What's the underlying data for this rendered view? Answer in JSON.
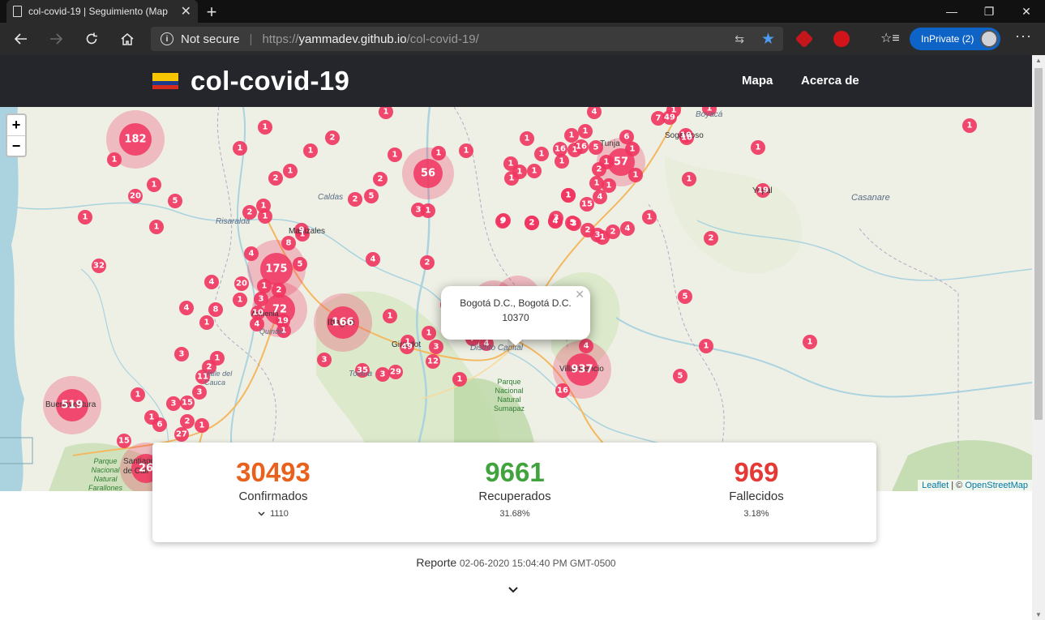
{
  "browser": {
    "tab_title": "col-covid-19 | Seguimiento (Map",
    "tab_close": "✕",
    "new_tab": "+",
    "window_controls": {
      "minimize": "—",
      "restore": "❐",
      "close": "✕"
    },
    "security_label": "Not secure",
    "url_scheme": "https://",
    "url_host": "yammadev.github.io",
    "url_path": "/col-covid-19/",
    "inprivate_label": "InPrivate (2)",
    "more": "···",
    "accent": "#0e63c6"
  },
  "header": {
    "brand": "col-covid-19",
    "menu": [
      "Mapa",
      "Acerca de"
    ],
    "background": "#24262b"
  },
  "map": {
    "zoom_in": "+",
    "zoom_out": "−",
    "attribution_leaflet": "Leaflet",
    "attribution_sep": " | © ",
    "attribution_osm": "OpenStreetMap",
    "popup": {
      "location": "Bogotá D.C., Bogotá D.C.",
      "value": "10370",
      "close": "✕"
    },
    "place_labels": [
      "Boyacá",
      "Sogamoso",
      "Casanare",
      "Yopal",
      "Caldas",
      "Risaralda",
      "Manizales",
      "Ibagué",
      "Girardot",
      "Tolima",
      "Distrito Capital",
      "Villavicencio",
      "Buenaventura",
      "Parque Nacional Natural Sumapaz",
      "Parque Nacional Natural Farallones",
      "Quindío",
      "Valle del Cauca",
      "Santiago de Cali",
      "Armenia",
      "Tunja"
    ],
    "marker_color": "#f0345f",
    "large_clusters": [
      {
        "label": "182"
      },
      {
        "label": "56"
      },
      {
        "label": "57"
      },
      {
        "label": "175"
      },
      {
        "label": "72"
      },
      {
        "label": "166"
      },
      {
        "label": "337"
      },
      {
        "label": "10370"
      },
      {
        "label": "937"
      },
      {
        "label": "519"
      },
      {
        "label": "26"
      }
    ],
    "small_markers": [
      "1",
      "2",
      "4",
      "5",
      "3",
      "6",
      "8",
      "9",
      "10",
      "12",
      "13",
      "14",
      "15",
      "16",
      "19",
      "20",
      "22",
      "27",
      "29",
      "32",
      "35",
      "49",
      "7",
      "11"
    ]
  },
  "stats": {
    "confirmed": {
      "value": "30493",
      "label": "Confirmados",
      "delta": "1110",
      "color": "#e8621d"
    },
    "recovered": {
      "value": "9661",
      "label": "Recuperados",
      "pct": "31.68%",
      "color": "#41a33d"
    },
    "deaths": {
      "value": "969",
      "label": "Fallecidos",
      "pct": "3.18%",
      "color": "#e53935"
    }
  },
  "report": {
    "label": "Reporte",
    "date": "02-06-2020 15:04:40 PM GMT-0500"
  }
}
